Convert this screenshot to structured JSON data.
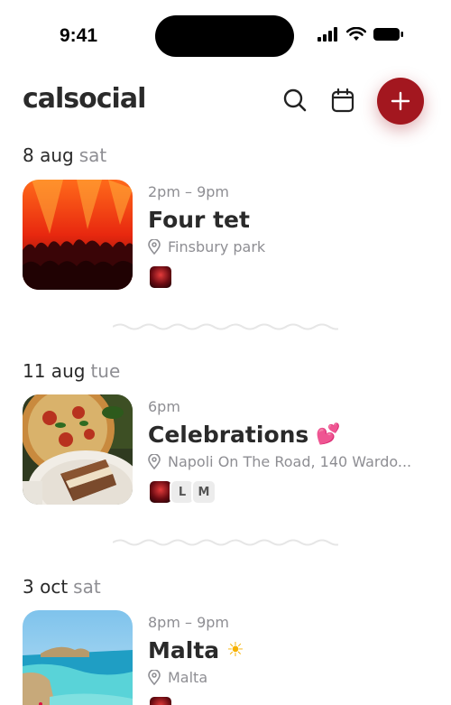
{
  "status_bar": {
    "time": "9:41"
  },
  "header": {
    "app_title": "calsocial"
  },
  "days": [
    {
      "date": "8 aug",
      "weekday": "sat"
    },
    {
      "date": "11 aug",
      "weekday": "tue"
    },
    {
      "date": "3 oct",
      "weekday": "sat"
    }
  ],
  "events": [
    {
      "time": "2pm – 9pm",
      "title": "Four tet",
      "emoji": "",
      "location": "Finsbury park",
      "attendees": []
    },
    {
      "time": "6pm",
      "title": "Celebrations",
      "emoji": "💕",
      "location": "Napoli On The Road, 140 Wardo...",
      "attendees": [
        "L",
        "M"
      ]
    },
    {
      "time": "8pm – 9pm",
      "title": "Malta",
      "emoji": "☀",
      "location": "Malta",
      "attendees": []
    }
  ],
  "colors": {
    "accent": "#a3171f",
    "text": "#2a2a2a",
    "muted": "#8e8e93"
  }
}
